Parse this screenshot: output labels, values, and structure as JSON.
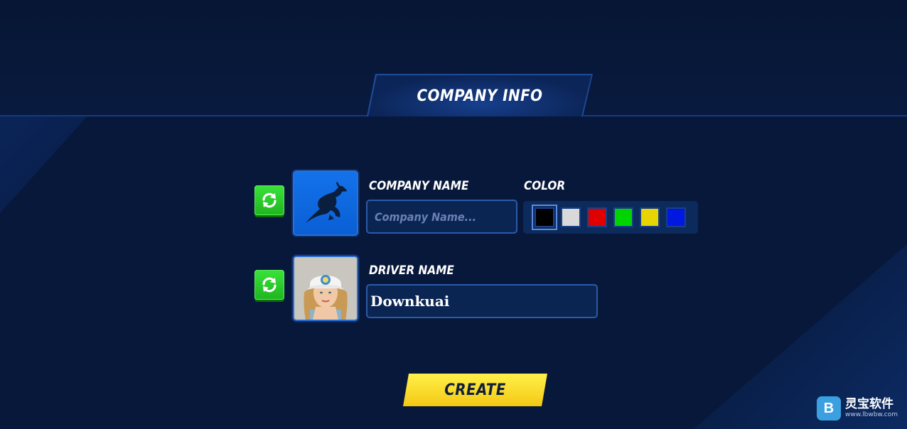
{
  "header": {
    "title": "COMPANY INFO"
  },
  "company": {
    "label": "COMPANY NAME",
    "input_value": "",
    "placeholder": "Company Name...",
    "logo_icon": "kangaroo-icon"
  },
  "color": {
    "label": "COLOR",
    "swatches": [
      "#000000",
      "#d9d9d9",
      "#e00000",
      "#00d400",
      "#e8d400",
      "#0018e0"
    ],
    "selected_index": 0
  },
  "driver": {
    "label": "DRIVER NAME",
    "input_value": "Downkuai",
    "avatar_icon": "driver-avatar"
  },
  "actions": {
    "create_label": "CREATE",
    "refresh_icon": "refresh-icon"
  },
  "watermark": {
    "logo": "B",
    "title": "灵宝软件",
    "url": "www.lbwbw.com"
  },
  "colors": {
    "background": "#07183a",
    "accent": "#2b5aa8",
    "create": "#f4c814",
    "refresh": "#1fb51f"
  }
}
